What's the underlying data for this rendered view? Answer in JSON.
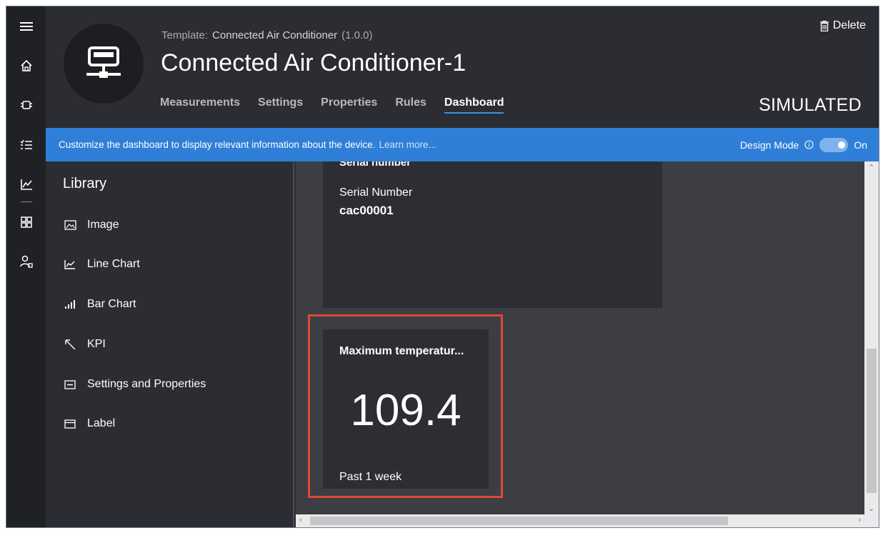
{
  "device": {
    "template_label": "Template:",
    "template_name": "Connected Air Conditioner",
    "template_version": "(1.0.0)",
    "title": "Connected Air Conditioner-1",
    "status": "SIMULATED"
  },
  "tabs": [
    {
      "label": "Measurements",
      "active": false
    },
    {
      "label": "Settings",
      "active": false
    },
    {
      "label": "Properties",
      "active": false
    },
    {
      "label": "Rules",
      "active": false
    },
    {
      "label": "Dashboard",
      "active": true
    }
  ],
  "actions": {
    "delete_label": "Delete"
  },
  "banner": {
    "text": "Customize the dashboard to display relevant information about the device.",
    "link": "Learn more...",
    "design_mode_label": "Design Mode",
    "toggle_state": "On"
  },
  "library": {
    "title": "Library",
    "items": [
      {
        "label": "Image",
        "icon": "image-icon"
      },
      {
        "label": "Line Chart",
        "icon": "line-chart-icon"
      },
      {
        "label": "Bar Chart",
        "icon": "bar-chart-icon"
      },
      {
        "label": "KPI",
        "icon": "kpi-arrow-icon"
      },
      {
        "label": "Settings and Properties",
        "icon": "settings-properties-icon"
      },
      {
        "label": "Label",
        "icon": "label-icon"
      }
    ]
  },
  "tiles": {
    "serial": {
      "title": "Serial number",
      "property_label": "Serial Number",
      "property_value": "cac00001"
    },
    "kpi": {
      "title": "Maximum temperatur...",
      "value": "109.4",
      "timeframe": "Past 1 week"
    }
  },
  "colors": {
    "accent": "#2f7fd8",
    "highlight": "#e04a2f",
    "background": "#2b2d32",
    "rail": "#202124"
  }
}
